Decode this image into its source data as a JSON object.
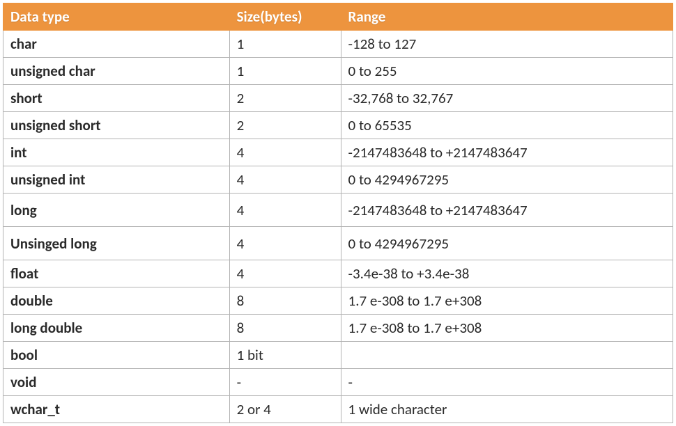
{
  "headers": {
    "col0": "Data type",
    "col1": "Size(bytes)",
    "col2": "Range"
  },
  "rows": [
    {
      "type": "char",
      "size": "1",
      "range": "-128 to 127"
    },
    {
      "type": "unsigned char",
      "size": "1",
      "range": "0 to 255"
    },
    {
      "type": "short",
      "size": "2",
      "range": "-32,768 to 32,767"
    },
    {
      "type": "unsigned short",
      "size": "2",
      "range": "0 to 65535"
    },
    {
      "type": "int",
      "size": "4",
      "range": "-2147483648  to +2147483647"
    },
    {
      "type": "unsigned int",
      "size": "4",
      "range": "0 to 4294967295"
    },
    {
      "type": "long",
      "size": "4",
      "range": "-2147483648  to +2147483647"
    },
    {
      "type": "Unsinged long",
      "size": "4",
      "range": "0 to 4294967295"
    },
    {
      "type": "float",
      "size": "4",
      "range": "-3.4e-38 to +3.4e-38"
    },
    {
      "type": "double",
      "size": "8",
      "range": "1.7 e-308 to 1.7 e+308"
    },
    {
      "type": "long double",
      "size": "8",
      "range": "1.7 e-308 to 1.7 e+308"
    },
    {
      "type": "bool",
      "size": "1 bit",
      "range": ""
    },
    {
      "type": "void",
      "size": "-",
      "range": "-"
    },
    {
      "type": "wchar_t",
      "size": "2 or 4",
      "range": "        1       wide character"
    }
  ],
  "chart_data": {
    "type": "table",
    "title": "",
    "columns": [
      "Data type",
      "Size(bytes)",
      "Range"
    ],
    "rows": [
      [
        "char",
        "1",
        "-128 to 127"
      ],
      [
        "unsigned char",
        "1",
        "0 to 255"
      ],
      [
        "short",
        "2",
        "-32,768 to 32,767"
      ],
      [
        "unsigned short",
        "2",
        "0 to 65535"
      ],
      [
        "int",
        "4",
        "-2147483648 to +2147483647"
      ],
      [
        "unsigned int",
        "4",
        "0 to 4294967295"
      ],
      [
        "long",
        "4",
        "-2147483648 to +2147483647"
      ],
      [
        "Unsinged long",
        "4",
        "0 to 4294967295"
      ],
      [
        "float",
        "4",
        "-3.4e-38 to +3.4e-38"
      ],
      [
        "double",
        "8",
        "1.7 e-308 to 1.7 e+308"
      ],
      [
        "long double",
        "8",
        "1.7 e-308 to 1.7 e+308"
      ],
      [
        "bool",
        "1 bit",
        ""
      ],
      [
        "void",
        "-",
        "-"
      ],
      [
        "wchar_t",
        "2 or 4",
        "1 wide character"
      ]
    ]
  }
}
